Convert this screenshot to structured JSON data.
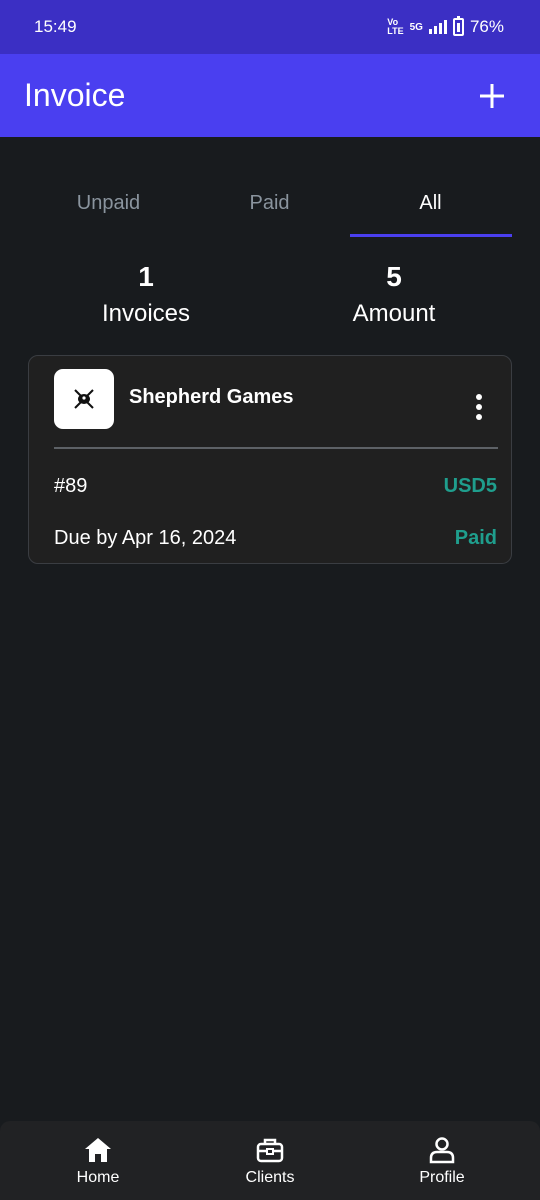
{
  "status_bar": {
    "time": "15:49",
    "net_top": "Vo",
    "net_bottom": "LTE",
    "network": "5G",
    "battery": "76%"
  },
  "app_bar": {
    "title": "Invoice",
    "add_icon": "plus-icon"
  },
  "tabs": [
    {
      "label": "Unpaid",
      "active": false
    },
    {
      "label": "Paid",
      "active": false
    },
    {
      "label": "All",
      "active": true
    }
  ],
  "summary": {
    "invoices_value": "1",
    "invoices_label": "Invoices",
    "amount_value": "5",
    "amount_label": "Amount"
  },
  "invoices": [
    {
      "client_name": "Shepherd Games",
      "logo_icon": "crossed-swords-icon",
      "number": "#89",
      "amount": "USD5",
      "due": "Due by Apr 16, 2024",
      "status": "Paid"
    }
  ],
  "bottom_nav": [
    {
      "label": "Home",
      "icon": "home-icon"
    },
    {
      "label": "Clients",
      "icon": "briefcase-icon"
    },
    {
      "label": "Profile",
      "icon": "user-icon"
    }
  ],
  "colors": {
    "status_bar": "#3b2fc4",
    "app_bar": "#4a3ff0",
    "background": "#181b1e",
    "card": "#202020",
    "accent_green": "#1f9e8d",
    "inactive_tab": "#8a949e"
  }
}
